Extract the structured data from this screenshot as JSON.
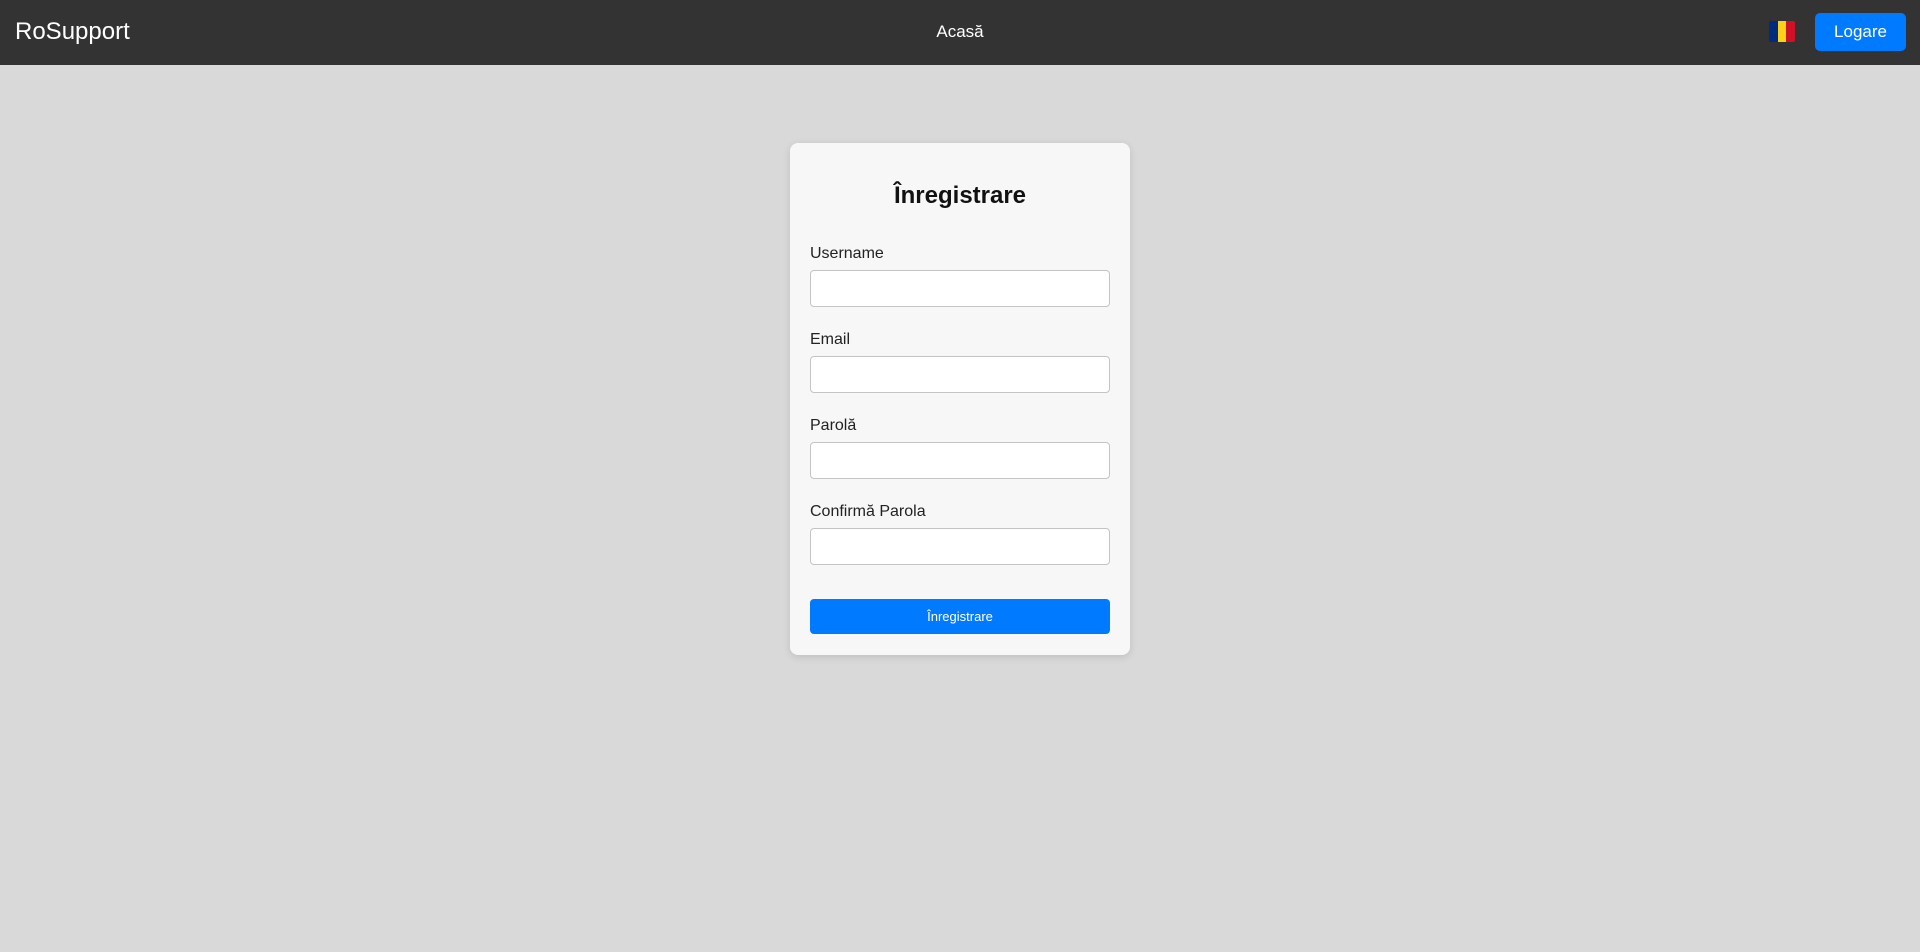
{
  "navbar": {
    "brand": "RoSupport",
    "home_link": "Acasă",
    "language_icon": "romania-flag-icon",
    "flag_colors": [
      "#002B7F",
      "#FCD116",
      "#CE1126"
    ],
    "login_label": "Logare"
  },
  "form": {
    "title": "Înregistrare",
    "fields": [
      {
        "label": "Username",
        "value": "",
        "placeholder": ""
      },
      {
        "label": "Email",
        "value": "",
        "placeholder": ""
      },
      {
        "label": "Parolă",
        "value": "",
        "placeholder": ""
      },
      {
        "label": "Confirmă Parola",
        "value": "",
        "placeholder": ""
      }
    ],
    "submit_label": "Înregistrare"
  },
  "colors": {
    "navbar_bg": "#333333",
    "page_bg": "#d9d9d9",
    "card_bg": "#f7f7f7",
    "accent": "#007bff"
  }
}
